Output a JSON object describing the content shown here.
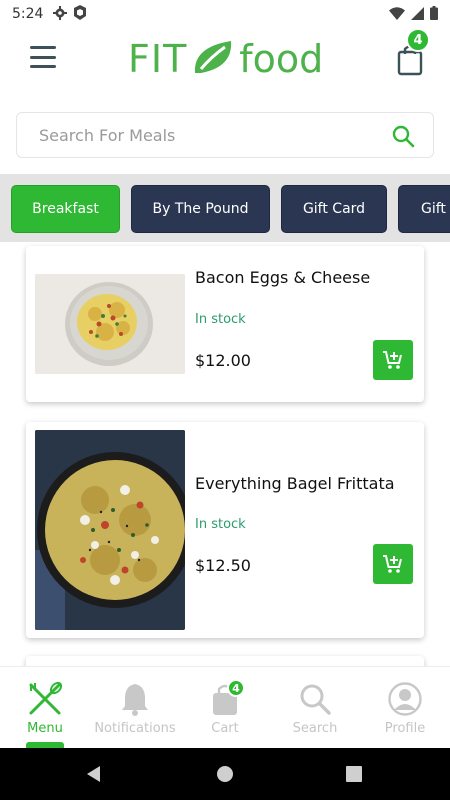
{
  "status_bar": {
    "time": "5:24",
    "left_icons": [
      "gear-icon",
      "shield-icon"
    ],
    "right_icons": [
      "wifi-icon",
      "cellular-icon",
      "battery-icon"
    ]
  },
  "header": {
    "logo_left": "FIT",
    "logo_right": "food",
    "cart_count": "4"
  },
  "search": {
    "placeholder": "Search For Meals"
  },
  "categories": [
    {
      "label": "Breakfast",
      "active": true
    },
    {
      "label": "By The Pound",
      "active": false
    },
    {
      "label": "Gift Card",
      "active": false
    },
    {
      "label": "Gift",
      "active": false
    }
  ],
  "products": [
    {
      "name": "Bacon Eggs & Cheese",
      "stock": "In stock",
      "price": "$12.00"
    },
    {
      "name": "Everything Bagel Frittata",
      "stock": "In stock",
      "price": "$12.50"
    }
  ],
  "bottom_nav": [
    {
      "label": "Menu",
      "icon": "fork-knife-icon",
      "active": true
    },
    {
      "label": "Notifications",
      "icon": "bell-icon",
      "active": false
    },
    {
      "label": "Cart",
      "icon": "bag-icon",
      "active": false,
      "badge": "4"
    },
    {
      "label": "Search",
      "icon": "search-icon",
      "active": false
    },
    {
      "label": "Profile",
      "icon": "profile-icon",
      "active": false
    }
  ],
  "colors": {
    "brand_green": "#2fb833",
    "category_navy": "#2b3752",
    "stock_text": "#2a9d6e"
  }
}
